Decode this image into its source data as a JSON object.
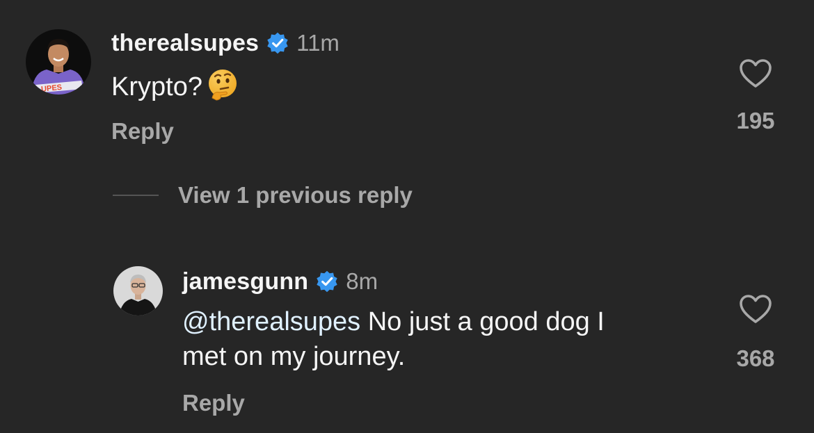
{
  "comments": [
    {
      "username": "therealsupes",
      "time": "11m",
      "text": "Krypto?",
      "emoji": "thinking-face",
      "reply_label": "Reply",
      "likes": "195",
      "avatar_shirt_text": "UPES"
    },
    {
      "username": "jamesgunn",
      "time": "8m",
      "mention": "@therealsupes",
      "text_line1": "No just a good dog I",
      "text_line2": "met on my journey.",
      "reply_label": "Reply",
      "likes": "368"
    }
  ],
  "view_replies": "View 1 previous reply",
  "colors": {
    "background": "#262626",
    "primary_text": "#f5f5f5",
    "secondary_text": "#a8a8a8",
    "verified": "#3897f0",
    "mention": "#e0f1ff"
  }
}
